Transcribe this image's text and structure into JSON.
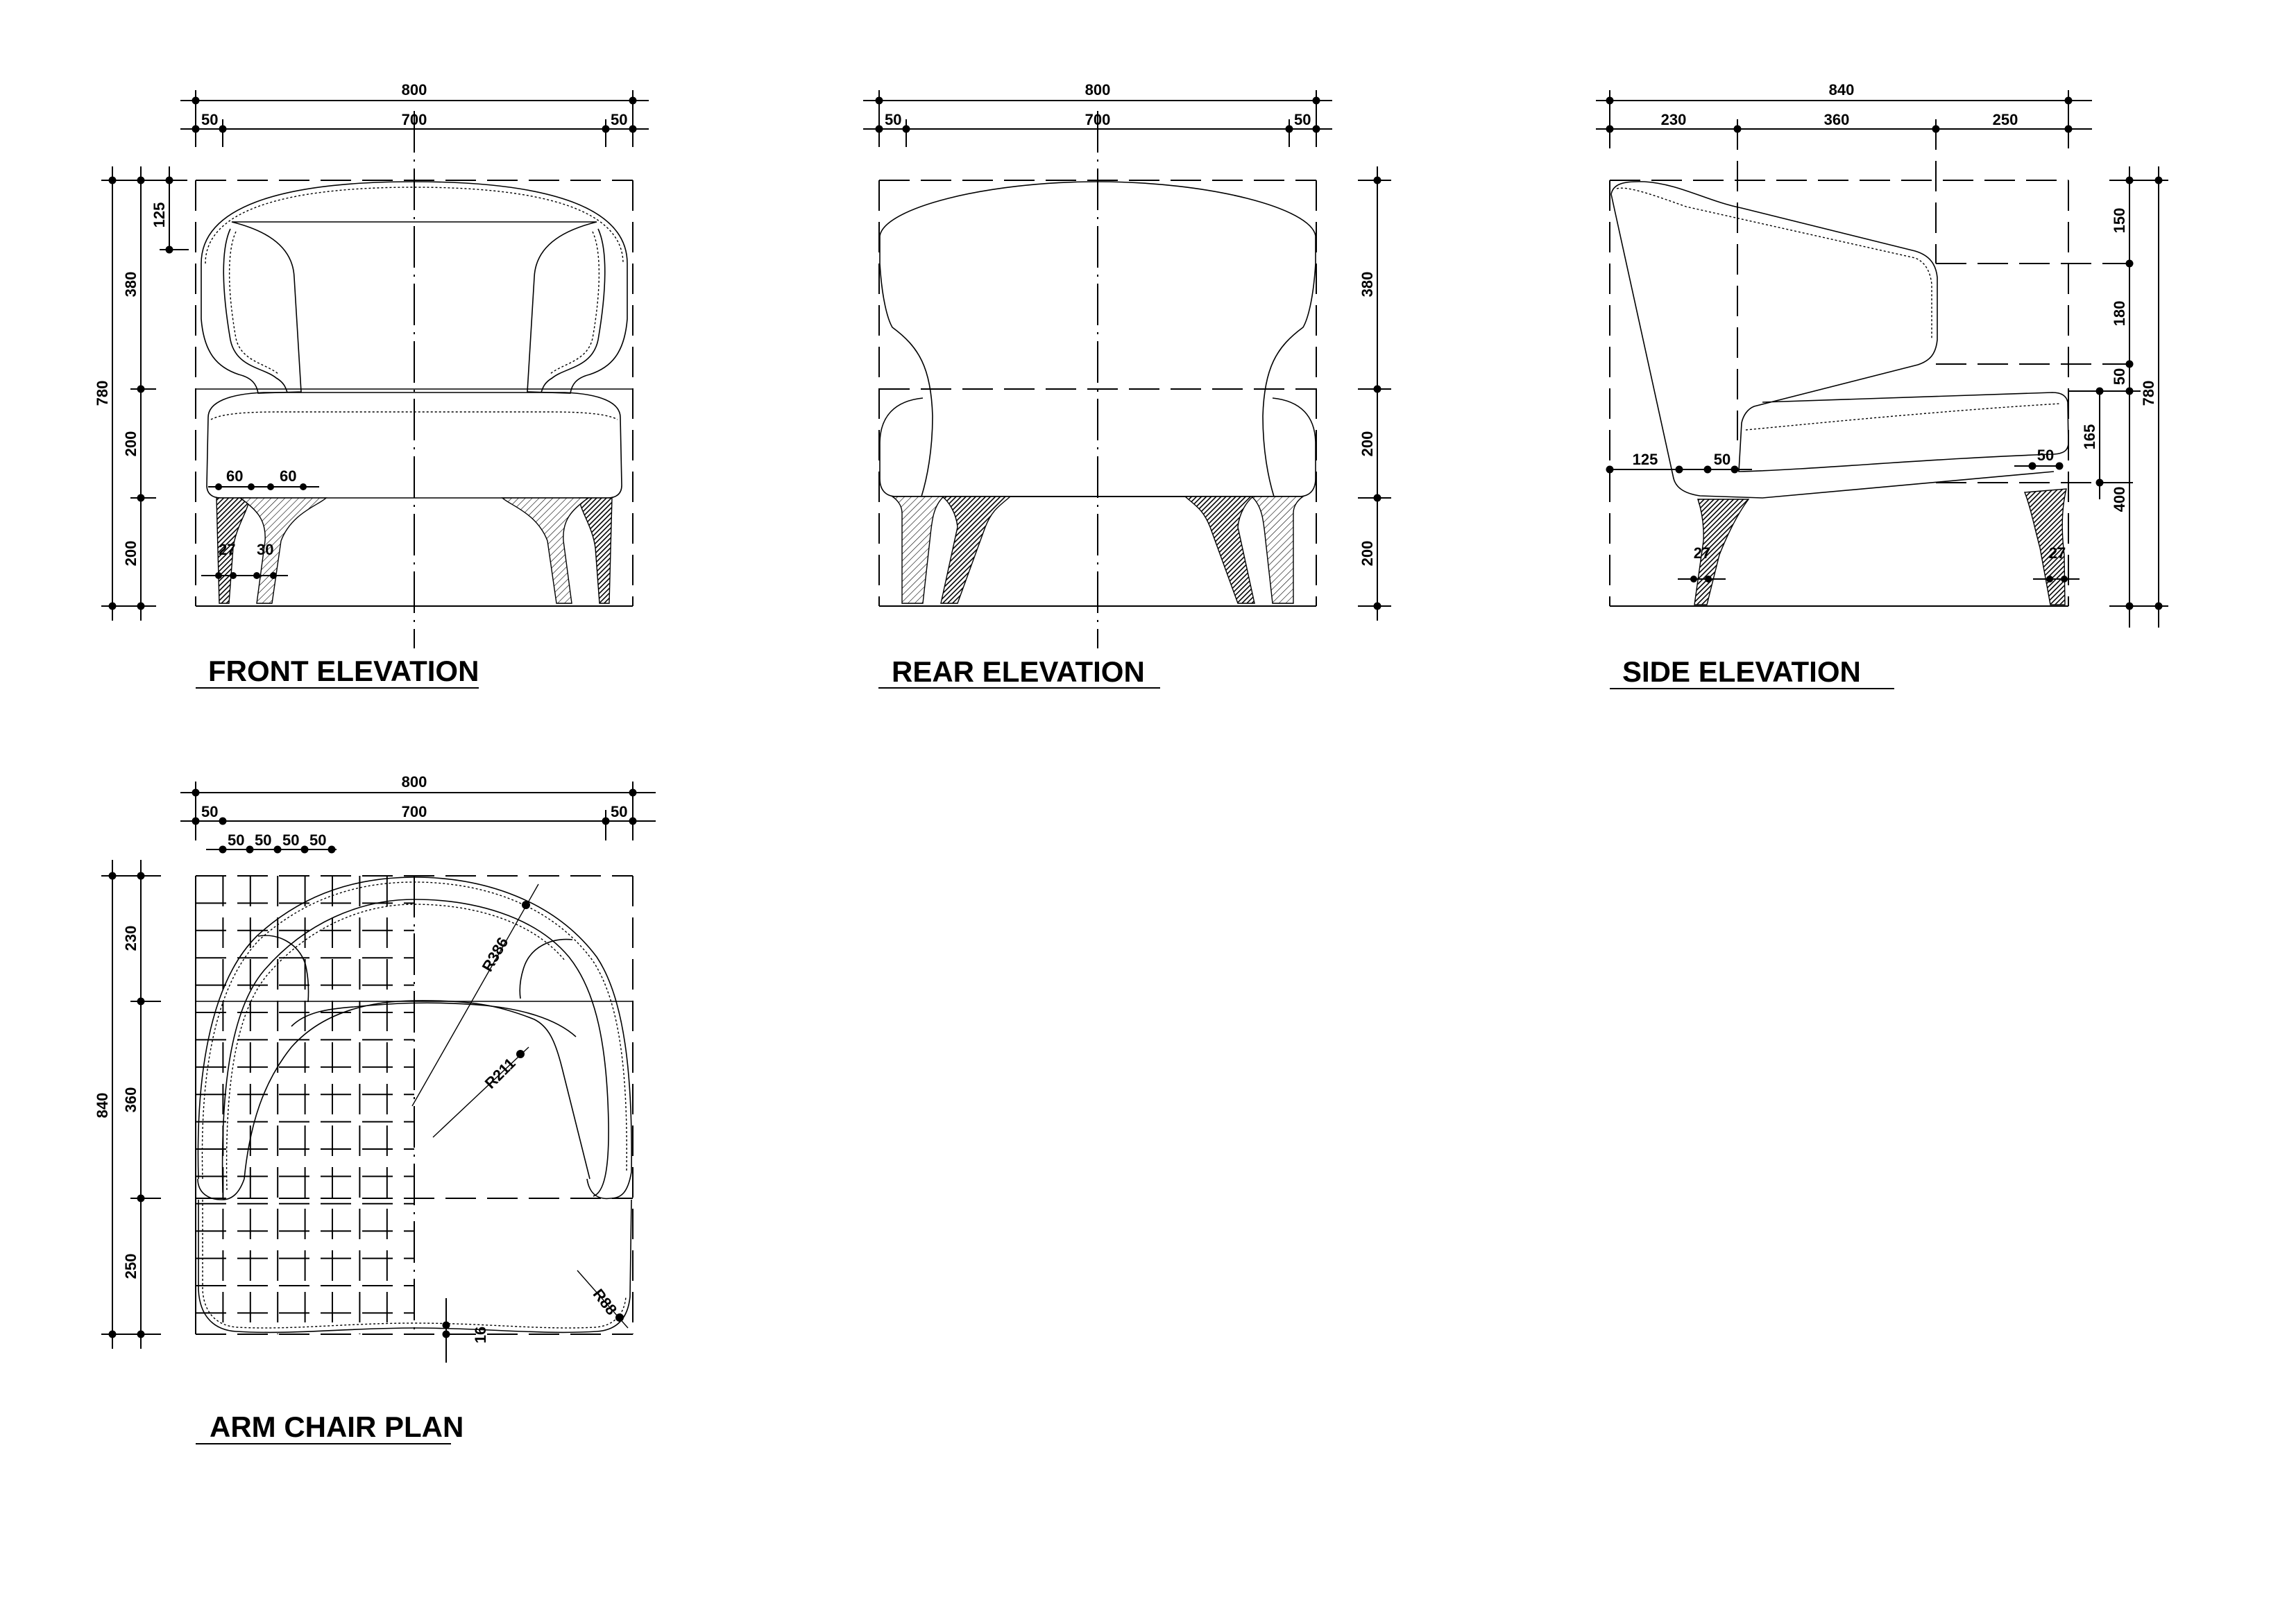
{
  "sheet": {
    "background": "#ffffff",
    "ink": "#000000"
  },
  "front_elevation": {
    "title": "FRONT ELEVATION",
    "top_dims": {
      "overall": "800",
      "left": "50",
      "middle": "700",
      "right": "50"
    },
    "left_dims": {
      "overall": "780",
      "back": "380",
      "back_top": "125",
      "seat": "200",
      "legs": "200"
    },
    "leg_dims": {
      "top_a": "60",
      "top_b": "60",
      "bottom_a": "27",
      "bottom_b": "30"
    }
  },
  "rear_elevation": {
    "title": "REAR ELEVATION",
    "top_dims": {
      "overall": "800",
      "left": "50",
      "middle": "700",
      "right": "50"
    },
    "right_dims": {
      "back": "380",
      "seat": "200",
      "legs": "200"
    }
  },
  "side_elevation": {
    "title": "SIDE ELEVATION",
    "top_dims": {
      "overall": "840",
      "a": "230",
      "b": "360",
      "c": "250"
    },
    "right_dims": {
      "overall": "780",
      "a": "150",
      "b": "180",
      "c": "50",
      "d": "165",
      "e": "400"
    },
    "leg_dims": {
      "front_offset": "125",
      "front_top": "50",
      "rear_top": "50",
      "front_bottom": "27",
      "rear_bottom": "27"
    }
  },
  "plan": {
    "title": "ARM CHAIR PLAN",
    "top_dims": {
      "overall": "800",
      "left": "50",
      "middle": "700",
      "right": "50",
      "grid": [
        "50",
        "50",
        "50",
        "50"
      ]
    },
    "left_dims": {
      "overall": "840",
      "a": "230",
      "b": "360",
      "c": "250"
    },
    "annotations": {
      "outer_radius": "R386",
      "inner_radius": "R211",
      "corner_radius": "R88",
      "front_offset": "16"
    }
  }
}
